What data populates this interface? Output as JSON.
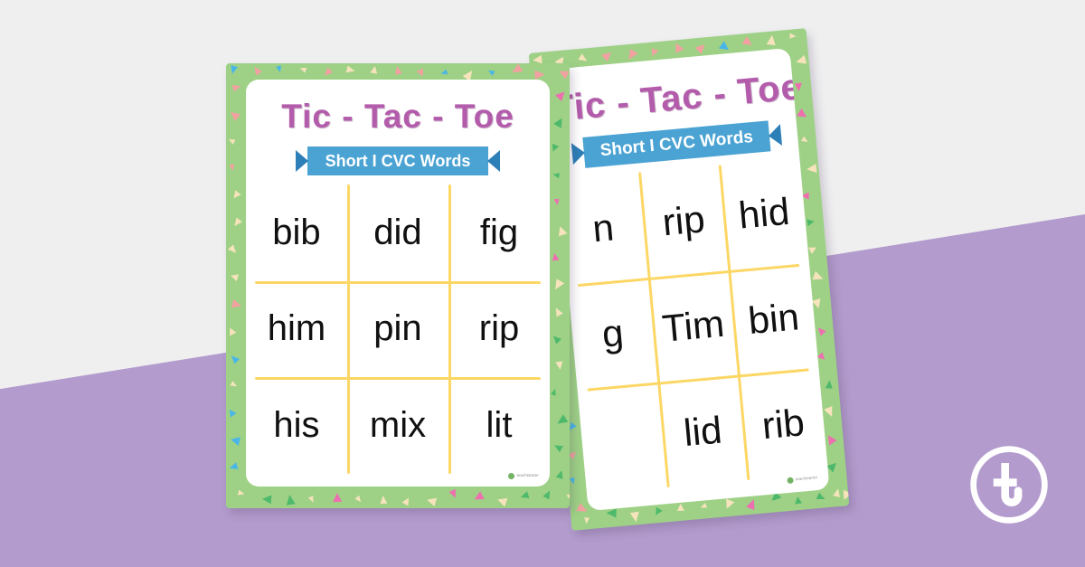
{
  "background": {
    "grey": "#efeff0",
    "purple": "#b39ccd"
  },
  "theme": {
    "border_green": "#9ed186",
    "title_purple": "#b35cab",
    "ribbon_blue": "#4ba3d3",
    "ribbon_tail_blue": "#2d7fb8",
    "grid_yellow": "#fcd765",
    "word_black": "#101010",
    "card_white": "#ffffff",
    "confetti_pink": "#f2a0a0",
    "confetti_magenta": "#ee6fb0",
    "confetti_cream": "#f6e3bc",
    "confetti_blue": "#49b6e8",
    "confetti_green": "#4eb96b"
  },
  "posters": {
    "front": {
      "title": "Tic - Tac - Toe",
      "subtitle": "Short I CVC Words",
      "rows": [
        [
          "bib",
          "did",
          "fig"
        ],
        [
          "him",
          "pin",
          "rip"
        ],
        [
          "his",
          "mix",
          "lit"
        ]
      ],
      "watermark": "teachstarter"
    },
    "back": {
      "title": "Tic - Tac - Toe",
      "subtitle": "Short I CVC Words",
      "rows": [
        [
          "n",
          "rip",
          "hid"
        ],
        [
          "g",
          "Tim",
          "bin"
        ],
        [
          "",
          "lid",
          "rib"
        ]
      ],
      "watermark": "teachstarter"
    }
  },
  "corner_logo": {
    "name": "teach-starter-logo",
    "letter": "t"
  }
}
